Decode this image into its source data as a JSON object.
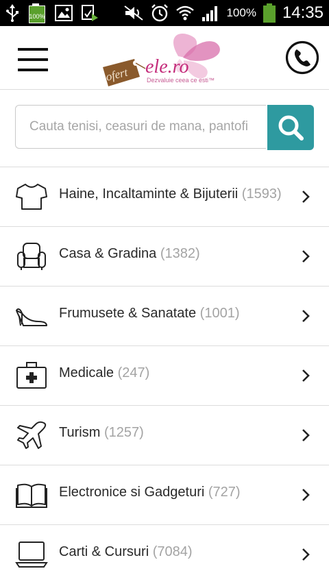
{
  "status_bar": {
    "battery_small_label": "100%",
    "battery_percent": "100%",
    "time": "14:35",
    "icons": [
      "usb-icon",
      "battery-charging-icon",
      "image-icon",
      "screenshot-icon",
      "mute-icon",
      "alarm-icon",
      "wifi-icon",
      "signal-icon",
      "battery-icon"
    ]
  },
  "header": {
    "logo": {
      "prefix": "ofert",
      "name": "ele.ro",
      "tagline": "Dezvaluie ceea ce esti™"
    },
    "icons": [
      "menu-icon",
      "phone-icon"
    ]
  },
  "search": {
    "placeholder": "Cauta tenisi, ceasuri de mana, pantofi",
    "button_icon": "search-icon",
    "accent_color": "#2e9aa0"
  },
  "categories": [
    {
      "label": "Haine, Incaltaminte & Bijuterii",
      "count": "(1593)",
      "icon": "tshirt-icon"
    },
    {
      "label": "Casa & Gradina",
      "count": "(1382)",
      "icon": "armchair-icon"
    },
    {
      "label": "Frumusete & Sanatate",
      "count": "(1001)",
      "icon": "high-heel-icon"
    },
    {
      "label": "Medicale",
      "count": "(247)",
      "icon": "medical-kit-icon"
    },
    {
      "label": "Turism",
      "count": "(1257)",
      "icon": "airplane-icon"
    },
    {
      "label": "Electronice si Gadgeturi",
      "count": "(727)",
      "icon": "book-icon"
    },
    {
      "label": "Carti & Cursuri",
      "count": "(7084)",
      "icon": "laptop-icon"
    }
  ]
}
